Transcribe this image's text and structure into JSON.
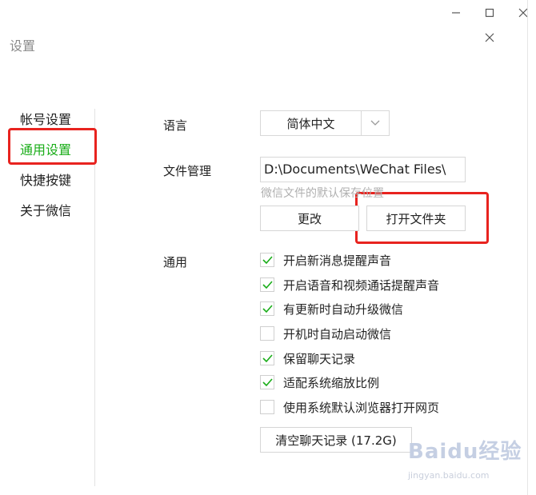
{
  "window": {
    "title": "设置"
  },
  "sidebar": {
    "items": [
      {
        "label": "帐号设置",
        "active": false
      },
      {
        "label": "通用设置",
        "active": true
      },
      {
        "label": "快捷按键",
        "active": false
      },
      {
        "label": "关于微信",
        "active": false
      }
    ]
  },
  "general": {
    "language_label": "语言",
    "language_value": "简体中文",
    "file_label": "文件管理",
    "file_path": "D:\\Documents\\WeChat Files\\",
    "file_hint": "微信文件的默认保存位置",
    "change_button": "更改",
    "open_folder_button": "打开文件夹",
    "section_label": "通用",
    "options": [
      {
        "label": "开启新消息提醒声音",
        "checked": true
      },
      {
        "label": "开启语音和视频通话提醒声音",
        "checked": true
      },
      {
        "label": "有更新时自动升级微信",
        "checked": true
      },
      {
        "label": "开机时自动启动微信",
        "checked": false
      },
      {
        "label": "保留聊天记录",
        "checked": true
      },
      {
        "label": "适配系统缩放比例",
        "checked": true
      },
      {
        "label": "使用系统默认浏览器打开网页",
        "checked": false
      }
    ],
    "clear_button": "清空聊天记录 (17.2G)"
  },
  "watermark": {
    "text": "Baidu经验",
    "sub": "jingyan.baidu.com"
  },
  "colors": {
    "accent": "#1aad19",
    "highlight": "#e8231f",
    "check": "#1aad19"
  }
}
